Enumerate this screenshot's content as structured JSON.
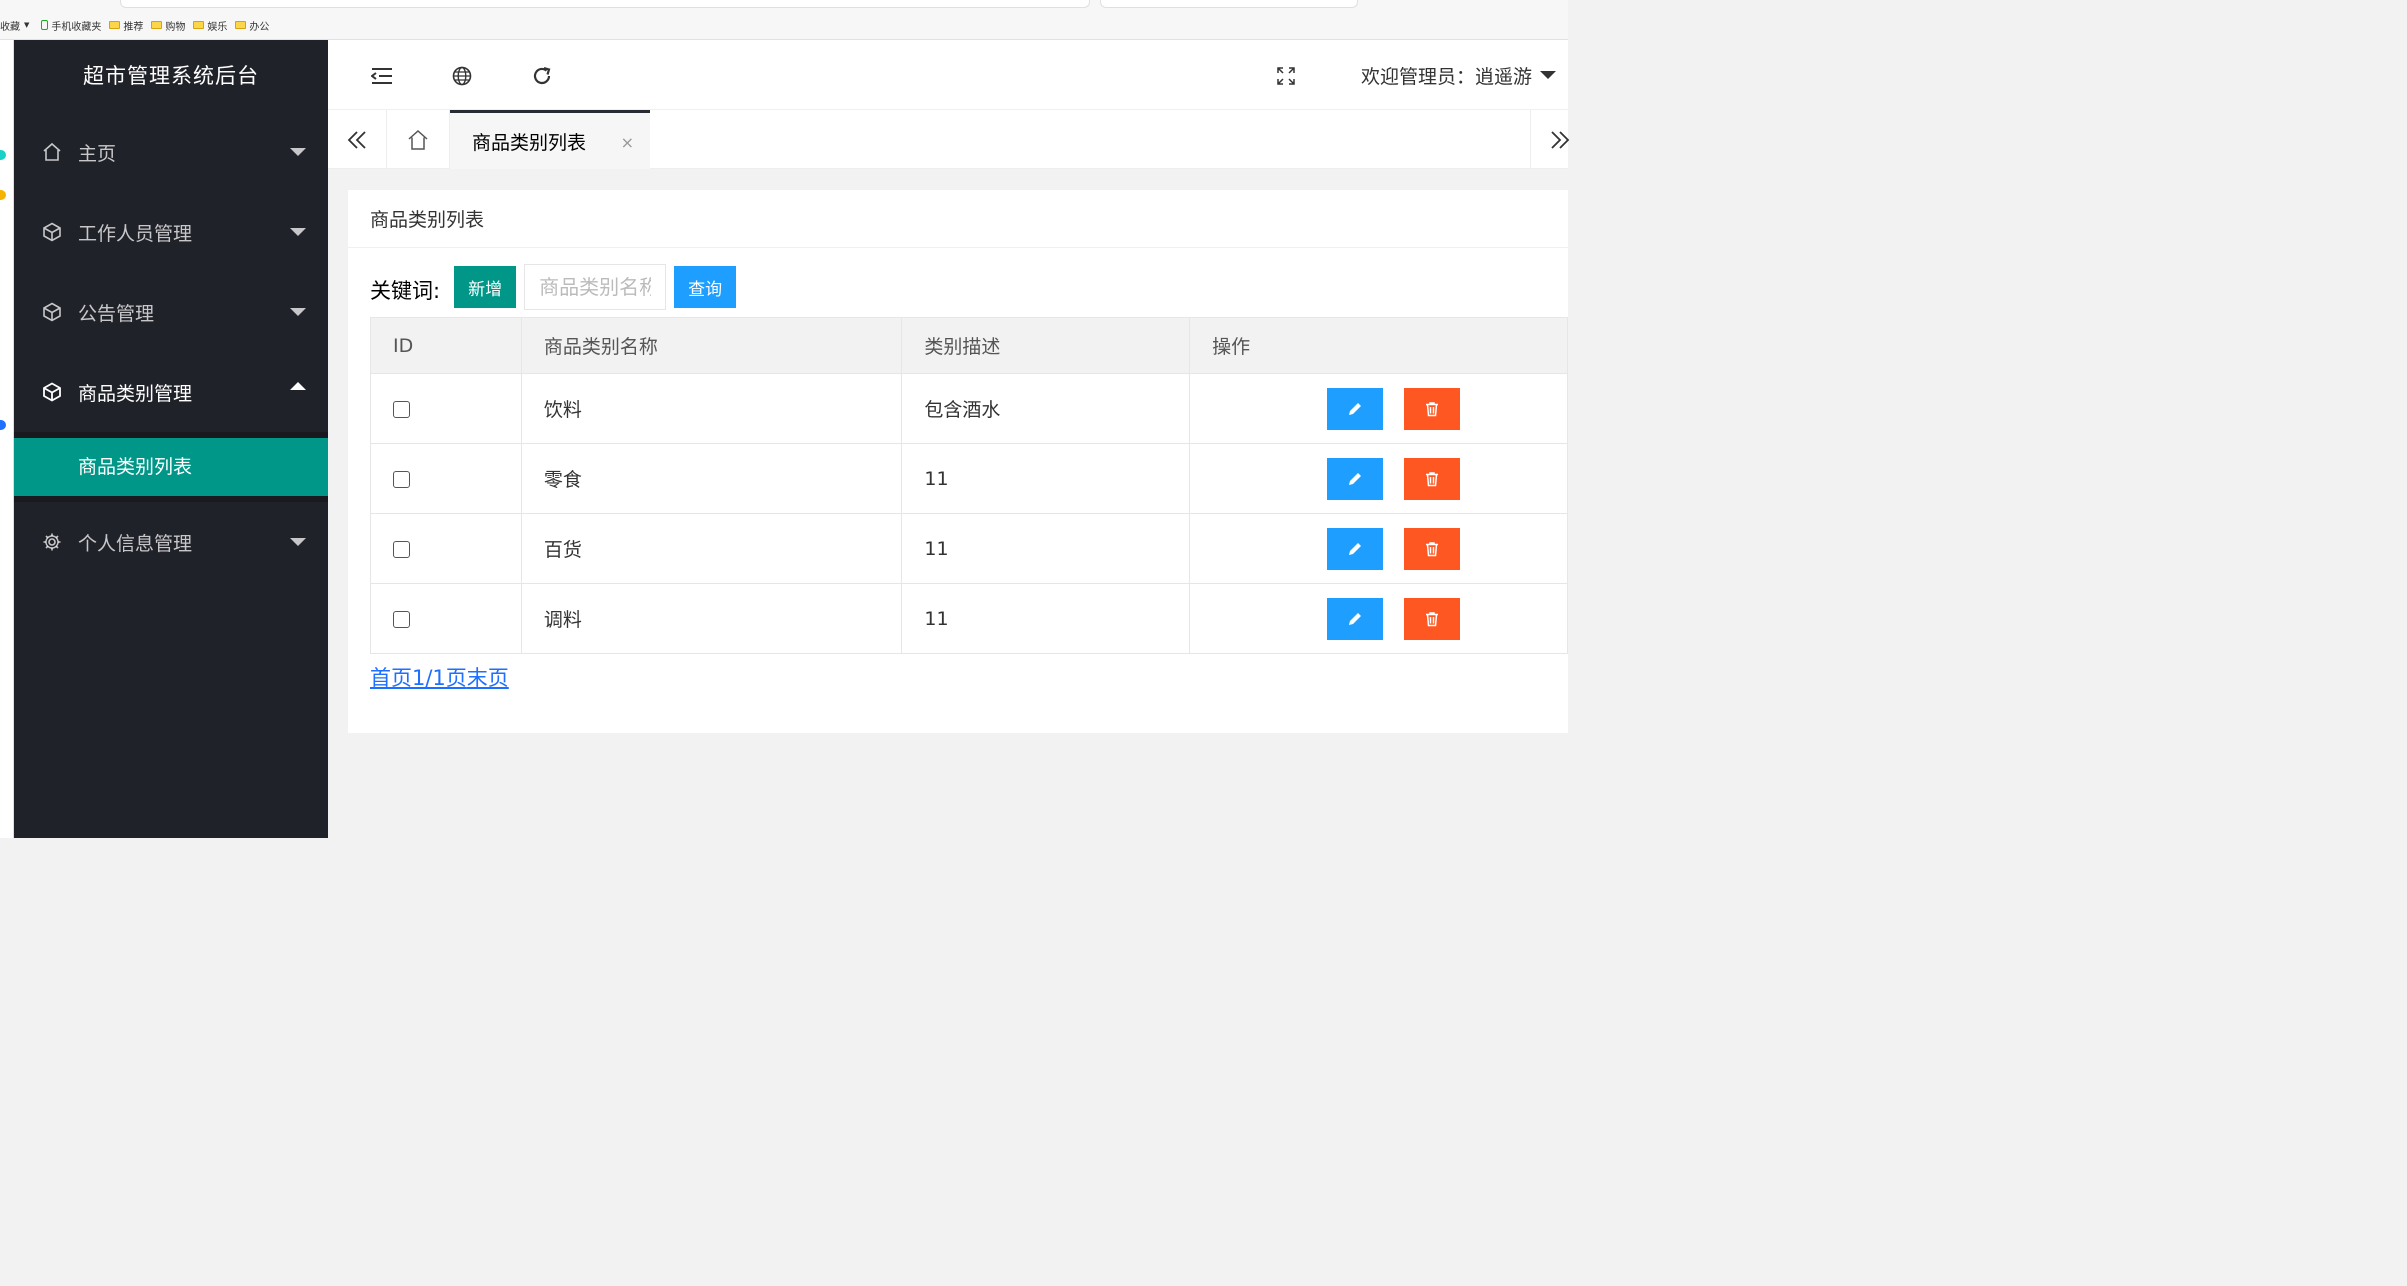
{
  "browser": {
    "bookmarks": {
      "collect": "收藏",
      "phone_fav": "手机收藏夹",
      "folders": [
        "推荐",
        "购物",
        "娱乐",
        "办公"
      ]
    }
  },
  "sidebar": {
    "logo": "超市管理系统后台",
    "items": [
      {
        "label": "主页",
        "icon": "home-icon"
      },
      {
        "label": "工作人员管理",
        "icon": "cube-icon"
      },
      {
        "label": "公告管理",
        "icon": "cube-icon"
      },
      {
        "label": "商品类别管理",
        "icon": "cube-icon",
        "expanded": true,
        "children": [
          "商品类别列表"
        ]
      },
      {
        "label": "个人信息管理",
        "icon": "gear-icon"
      }
    ]
  },
  "header": {
    "icons": [
      "menu-fold-icon",
      "globe-icon",
      "refresh-icon",
      "fullscreen-icon"
    ],
    "welcome": "欢迎管理员：逍遥游"
  },
  "tabs": {
    "active": "商品类别列表",
    "close_label": "×"
  },
  "content": {
    "title": "商品类别列表",
    "search": {
      "label": "关键词:",
      "add": "新增",
      "placeholder": "商品类别名称",
      "query": "查询"
    },
    "table": {
      "columns": [
        "ID",
        "商品类别名称",
        "类别描述",
        "操作"
      ],
      "rows": [
        {
          "name": "饮料",
          "desc": "包含酒水"
        },
        {
          "name": "零食",
          "desc": "11"
        },
        {
          "name": "百货",
          "desc": "11"
        },
        {
          "name": "调料",
          "desc": "11"
        }
      ]
    },
    "pager": {
      "first": "首页",
      "info": "1/1页",
      "last": "末页"
    }
  },
  "colors": {
    "sidebar_bg": "#20222a",
    "accent_green": "#009688",
    "accent_blue": "#1e9fff",
    "danger": "#ff5722"
  }
}
